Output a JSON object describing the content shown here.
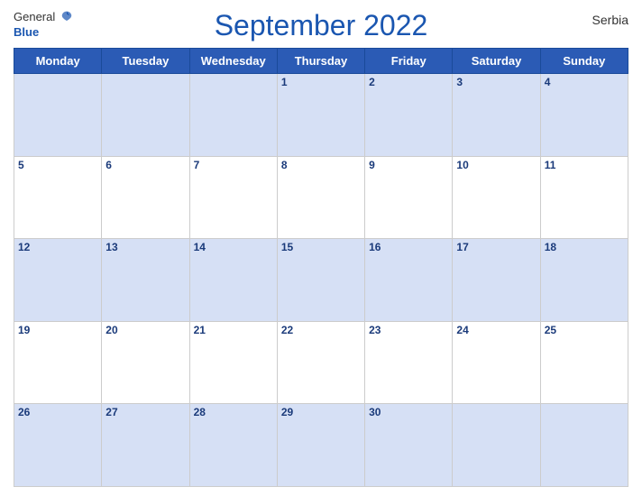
{
  "header": {
    "logo_general": "General",
    "logo_blue": "Blue",
    "title": "September 2022",
    "country": "Serbia"
  },
  "days_of_week": [
    "Monday",
    "Tuesday",
    "Wednesday",
    "Thursday",
    "Friday",
    "Saturday",
    "Sunday"
  ],
  "weeks": [
    [
      "",
      "",
      "",
      "1",
      "2",
      "3",
      "4"
    ],
    [
      "5",
      "6",
      "7",
      "8",
      "9",
      "10",
      "11"
    ],
    [
      "12",
      "13",
      "14",
      "15",
      "16",
      "17",
      "18"
    ],
    [
      "19",
      "20",
      "21",
      "22",
      "23",
      "24",
      "25"
    ],
    [
      "26",
      "27",
      "28",
      "29",
      "30",
      "",
      ""
    ]
  ]
}
